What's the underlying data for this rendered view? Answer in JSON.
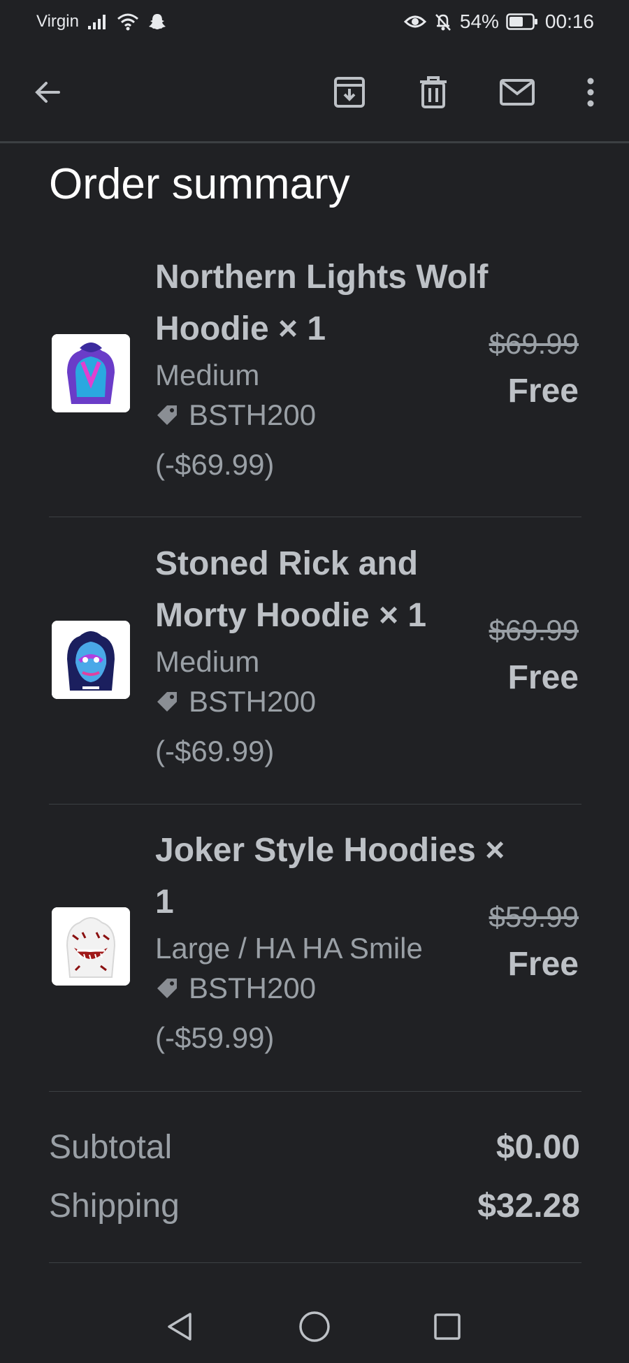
{
  "status_bar": {
    "carrier": "Virgin",
    "battery": "54%",
    "time": "00:16"
  },
  "toolbar": {
    "icons": [
      "back-arrow-icon",
      "archive-icon",
      "delete-icon",
      "mail-icon",
      "more-vert-icon"
    ]
  },
  "page": {
    "title": "Order summary"
  },
  "items": [
    {
      "name": "Northern Lights Wolf Hoodie × 1",
      "variant": "Medium",
      "discount_code": "BSTH200",
      "discount_amount": "(-$69.99)",
      "original_price": "$69.99",
      "price": "Free"
    },
    {
      "name": "Stoned Rick and Morty Hoodie × 1",
      "variant": "Medium",
      "discount_code": "BSTH200",
      "discount_amount": "(-$69.99)",
      "original_price": "$69.99",
      "price": "Free"
    },
    {
      "name": "Joker Style Hoodies × 1",
      "variant": "Large / HA HA Smile",
      "discount_code": "BSTH200",
      "discount_amount": "(-$59.99)",
      "original_price": "$59.99",
      "price": "Free"
    }
  ],
  "totals": {
    "subtotal_label": "Subtotal",
    "subtotal_value": "$0.00",
    "shipping_label": "Shipping",
    "shipping_value": "$32.28"
  },
  "colors": {
    "background": "#202124",
    "text_primary": "#bdc1c6",
    "text_secondary": "#9aa0a6",
    "divider": "#3c4043"
  }
}
